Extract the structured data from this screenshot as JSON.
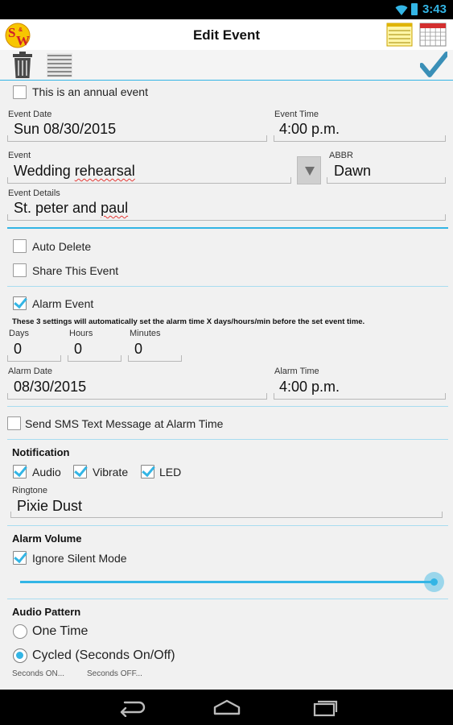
{
  "status_bar": {
    "time": "3:43"
  },
  "header": {
    "title": "Edit Event"
  },
  "form": {
    "annual_label": "This is an annual event",
    "event_date_label": "Event Date",
    "event_date_value": "Sun  08/30/2015",
    "event_time_label": "Event Time",
    "event_time_value": "4:00 p.m.",
    "event_label": "Event",
    "event_value_1": "Wedding ",
    "event_value_2": "rehearsal",
    "abbr_label": "ABBR",
    "abbr_value": "Dawn",
    "details_label": "Event Details",
    "details_value_1": "St. peter and ",
    "details_value_2": "paul",
    "auto_delete_label": "Auto Delete",
    "share_label": "Share This Event",
    "alarm_event_label": "Alarm Event",
    "alarm_note": "These 3 settings will automatically set the alarm time X days/hours/min before the set event time.",
    "days_label": "Days",
    "days_value": "0",
    "hours_label": "Hours",
    "hours_value": "0",
    "minutes_label": "Minutes",
    "minutes_value": "0",
    "alarm_date_label": "Alarm Date",
    "alarm_date_value": "08/30/2015",
    "alarm_time_label": "Alarm Time",
    "alarm_time_value": "4:00 p.m.",
    "sms_label": "Send SMS Text Message at Alarm Time",
    "notification_title": "Notification",
    "audio_label": "Audio",
    "vibrate_label": "Vibrate",
    "led_label": "LED",
    "ringtone_label": "Ringtone",
    "ringtone_value": "Pixie Dust",
    "alarm_volume_title": "Alarm Volume",
    "ignore_silent_label": "Ignore Silent Mode",
    "alarm_volume_level": 1.0,
    "audio_pattern_title": "Audio Pattern",
    "one_time_label": "One Time",
    "cycled_label": "Cycled (Seconds On/Off)",
    "seconds_on_label": "Seconds ON...",
    "seconds_off_label": "Seconds OFF..."
  },
  "checkbox_state": {
    "annual": false,
    "auto_delete": false,
    "share": false,
    "alarm_event": true,
    "sms": false,
    "audio": true,
    "vibrate": true,
    "led": true,
    "ignore_silent": true
  },
  "audio_pattern_selected": "cycled",
  "colors": {
    "accent": "#33b5e5",
    "status_bar": "#000000",
    "background": "#f1f1f1"
  },
  "icons": [
    "wifi-icon",
    "battery-icon",
    "app-logo-icon",
    "notes-icon",
    "calendar-icon",
    "trash-icon",
    "list-icon",
    "save-check-icon",
    "back-icon",
    "home-icon",
    "recent-apps-icon"
  ]
}
